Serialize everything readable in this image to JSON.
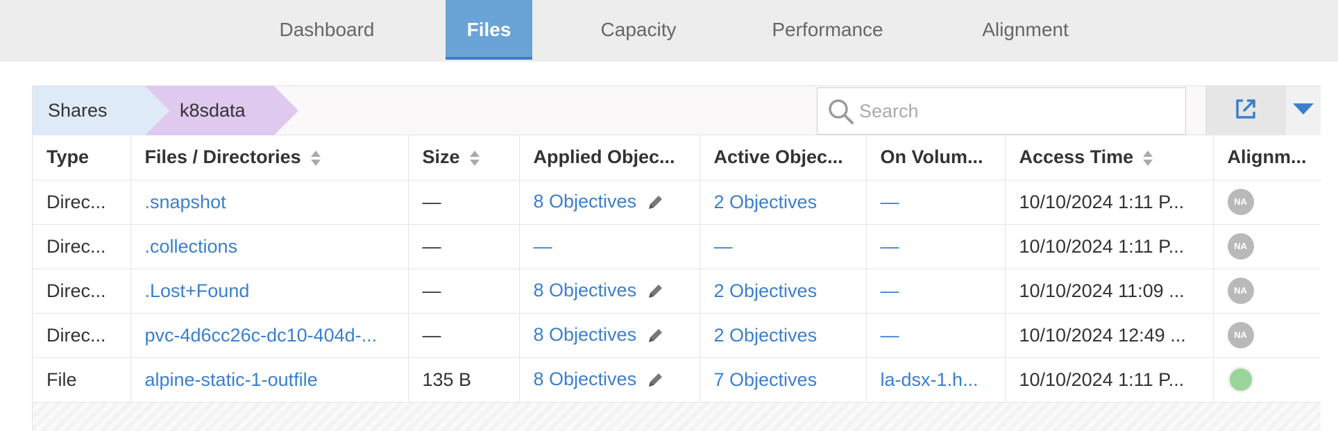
{
  "nav": {
    "tabs": [
      {
        "label": "Dashboard",
        "active": false
      },
      {
        "label": "Files",
        "active": true
      },
      {
        "label": "Capacity",
        "active": false
      },
      {
        "label": "Performance",
        "active": false
      },
      {
        "label": "Alignment",
        "active": false
      }
    ]
  },
  "breadcrumb": [
    "Shares",
    "k8sdata"
  ],
  "search": {
    "placeholder": "Search",
    "value": ""
  },
  "table": {
    "columns": [
      "Type",
      "Files / Directories",
      "Size",
      "Applied Objec...",
      "Active Objec...",
      "On Volum...",
      "Access Time",
      "Alignm..."
    ],
    "rows": [
      {
        "type": "Direc...",
        "name": ".snapshot",
        "size": "—",
        "applied": "8 Objectives",
        "applied_editable": true,
        "active": "2 Objectives",
        "volume": "—",
        "access_time": "10/10/2024 1:11 P...",
        "alignment": "NA"
      },
      {
        "type": "Direc...",
        "name": ".collections",
        "size": "—",
        "applied": "—",
        "applied_editable": false,
        "active": "—",
        "volume": "—",
        "access_time": "10/10/2024 1:11 P...",
        "alignment": "NA"
      },
      {
        "type": "Direc...",
        "name": ".Lost+Found",
        "size": "—",
        "applied": "8 Objectives",
        "applied_editable": true,
        "active": "2 Objectives",
        "volume": "—",
        "access_time": "10/10/2024 11:09 ...",
        "alignment": "NA"
      },
      {
        "type": "Direc...",
        "name": "pvc-4d6cc26c-dc10-404d-...",
        "size": "—",
        "applied": "8 Objectives",
        "applied_editable": true,
        "active": "2 Objectives",
        "volume": "—",
        "access_time": "10/10/2024 12:49 ...",
        "alignment": "NA"
      },
      {
        "type": "File",
        "name": "alpine-static-1-outfile",
        "size": "135 B",
        "applied": "8 Objectives",
        "applied_editable": true,
        "active": "7 Objectives",
        "volume": "la-dsx-1.h...",
        "access_time": "10/10/2024 1:11 P...",
        "alignment": ""
      }
    ]
  },
  "colors": {
    "active_tab": "#6aa3d6",
    "link": "#3a7fce",
    "aligned_ok": "#9bd49b",
    "na_badge": "#b9b9b9"
  }
}
